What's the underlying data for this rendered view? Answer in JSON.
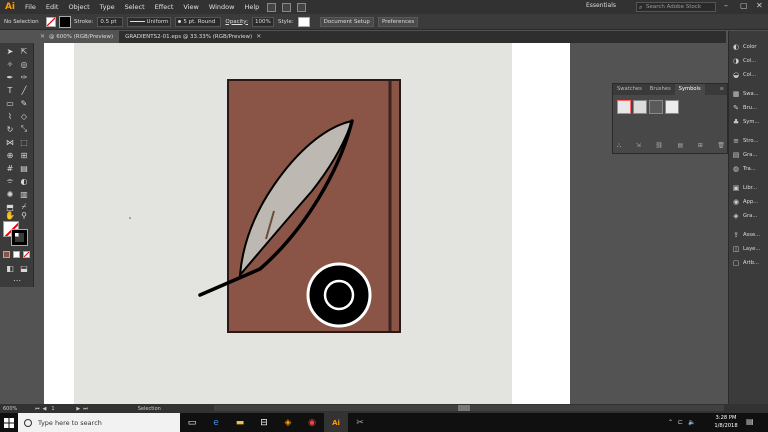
{
  "app": {
    "logo": "Ai",
    "menu": [
      "File",
      "Edit",
      "Object",
      "Type",
      "Select",
      "Effect",
      "View",
      "Window",
      "Help"
    ],
    "workspace": "Essentials",
    "search_placeholder": "Search Adobe Stock"
  },
  "control_bar": {
    "selection_label": "No Selection",
    "stroke_label": "Stroke:",
    "stroke_value": "0.5 pt",
    "profile_value": "Uniform",
    "brush_value": "5 pt. Round",
    "opacity_label": "Opacity:",
    "opacity_value": "100%",
    "style_label": "Style:",
    "document_setup": "Document Setup",
    "preferences": "Preferences"
  },
  "doc_tabs": [
    {
      "label": "@ 600% (RGB/Preview)",
      "active": true
    },
    {
      "label": "GRADIENTS2-01.eps @ 33.33% (RGB/Preview)",
      "active": false
    }
  ],
  "symbols_panel": {
    "tabs": [
      "Swatches",
      "Brushes",
      "Symbols"
    ],
    "active_tab": "Symbols"
  },
  "right_dock": [
    {
      "label": "Color",
      "icon": "color-icon"
    },
    {
      "label": "Col...",
      "icon": "color-guide-icon"
    },
    {
      "label": "Col...",
      "icon": "color-themes-icon"
    },
    {
      "label": "Swa...",
      "icon": "swatches-icon"
    },
    {
      "label": "Bru...",
      "icon": "brushes-icon"
    },
    {
      "label": "Sym...",
      "icon": "symbols-icon"
    },
    {
      "label": "Stro...",
      "icon": "stroke-icon"
    },
    {
      "label": "Gra...",
      "icon": "gradient-icon"
    },
    {
      "label": "Tra...",
      "icon": "transparency-icon"
    },
    {
      "label": "Libr...",
      "icon": "libraries-icon"
    },
    {
      "label": "App...",
      "icon": "appearance-icon"
    },
    {
      "label": "Gra...",
      "icon": "graphic-styles-icon"
    },
    {
      "label": "Asse...",
      "icon": "asset-export-icon"
    },
    {
      "label": "Laye...",
      "icon": "layers-icon"
    },
    {
      "label": "Artb...",
      "icon": "artboards-icon"
    }
  ],
  "status": {
    "zoom": "600%",
    "artboard_num": "1",
    "tool": "Selection"
  },
  "taskbar": {
    "search_placeholder": "Type here to search",
    "time": "3:28 PM",
    "date": "1/8/2018"
  },
  "artwork": {
    "book_color": "#8a5547",
    "feather_color": "#bdb8b2",
    "ink_color": "#000000"
  }
}
